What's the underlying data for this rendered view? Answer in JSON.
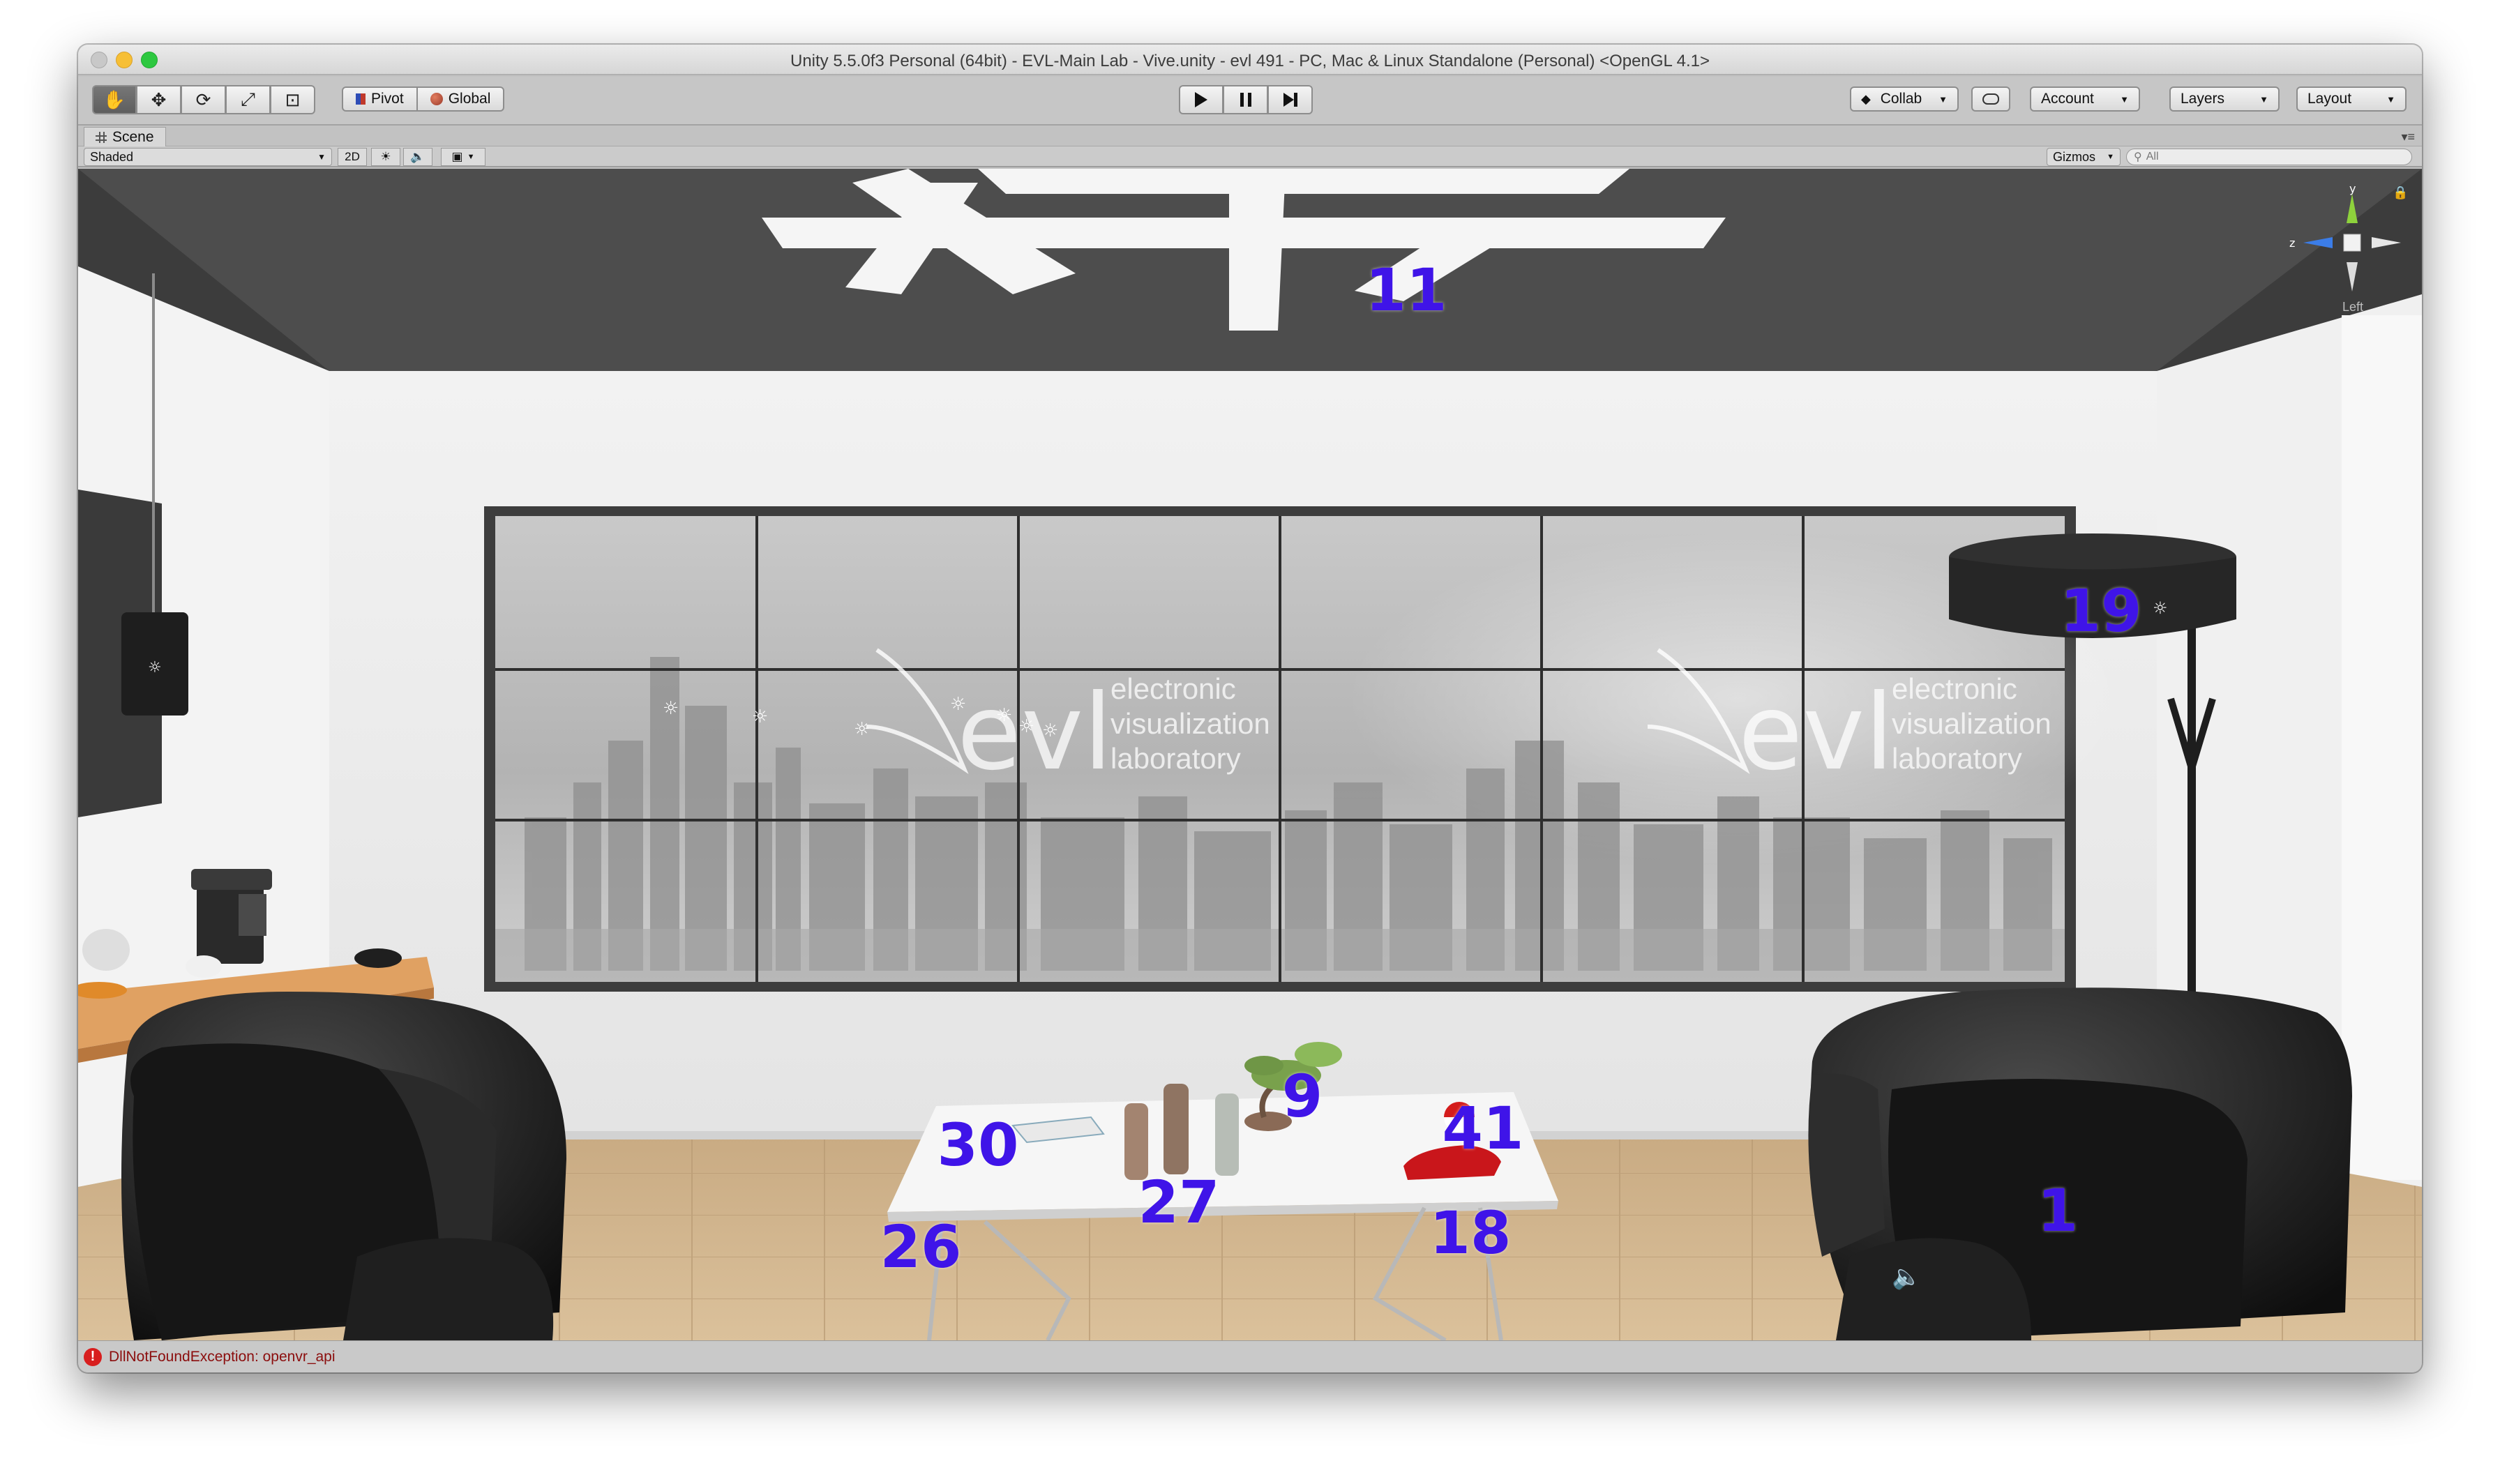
{
  "window": {
    "title": "Unity 5.5.0f3 Personal (64bit) - EVL-Main Lab - Vive.unity - evl 491 - PC, Mac & Linux Standalone (Personal) <OpenGL 4.1>"
  },
  "toolbar": {
    "transform_tools": [
      "hand-icon",
      "move-icon",
      "rotate-icon",
      "scale-icon",
      "rect-tool-icon"
    ],
    "pivot_label": "Pivot",
    "global_label": "Global",
    "playback": [
      "play-icon",
      "pause-icon",
      "step-icon"
    ],
    "collab_label": "Collab",
    "account_label": "Account",
    "layers_label": "Layers",
    "layout_label": "Layout"
  },
  "scene_panel": {
    "tab_label": "Scene",
    "shading_mode": "Shaded",
    "mode_2d_label": "2D",
    "gizmos_label": "Gizmos",
    "search_placeholder": "All",
    "orientation_label": "Left",
    "gizmo_axes": {
      "y": "y",
      "z": "z"
    }
  },
  "scene": {
    "wall_text": [
      "electronic",
      "visualization",
      "laboratory"
    ],
    "logo_text": "evl",
    "markers": [
      "11",
      "19",
      "9",
      "30",
      "41",
      "27",
      "26",
      "18",
      "1"
    ],
    "colors": {
      "marker": "#3f14e8",
      "ceiling": "#4a4a4a",
      "wall": "#ebebeb",
      "floor": "#d6b88f",
      "chair": "#1a1a1a"
    }
  },
  "status": {
    "error_message": "DllNotFoundException: openvr_api"
  }
}
